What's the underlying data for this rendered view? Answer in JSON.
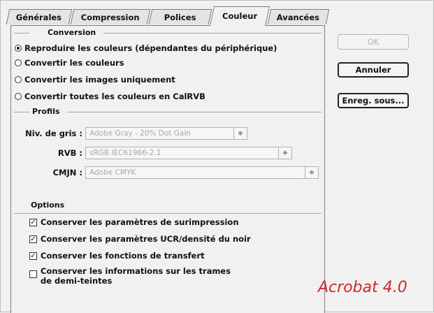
{
  "tabs": [
    "Générales",
    "Compression",
    "Polices",
    "Couleur",
    "Avancées"
  ],
  "active_tab": "Couleur",
  "conversion": {
    "title": "Conversion",
    "options": [
      {
        "label": "Reproduire les couleurs (dépendantes du périphérique)",
        "selected": true
      },
      {
        "label": "Convertir les couleurs",
        "selected": false
      },
      {
        "label": "Convertir les images uniquement",
        "selected": false
      },
      {
        "label": "Convertir toutes les couleurs en CalRVB",
        "selected": false
      }
    ]
  },
  "profils": {
    "title": "Profils",
    "gray_label": "Niv. de gris :",
    "gray_value": "Adobe Gray - 20% Dot Gain",
    "rvb_label": "RVB :",
    "rvb_value": "sRGB IEC61966-2.1",
    "cmjn_label": "CMJN :",
    "cmjn_value": "Adobe CMYK"
  },
  "options": {
    "title": "Options",
    "items": [
      {
        "label": "Conserver les paramètres de surimpression",
        "checked": true
      },
      {
        "label": "Conserver les paramètres UCR/densité du noir",
        "checked": true
      },
      {
        "label": "Conserver les fonctions de transfert",
        "checked": true
      },
      {
        "label": "Conserver les informations sur les trames",
        "label2": "de demi-teintes",
        "checked": false
      }
    ]
  },
  "buttons": {
    "ok": "OK",
    "cancel": "Annuler",
    "save_as": "Enreg. sous..."
  },
  "watermark": "Acrobat 4.0",
  "colors": {
    "watermark": "#cc2b2b"
  }
}
